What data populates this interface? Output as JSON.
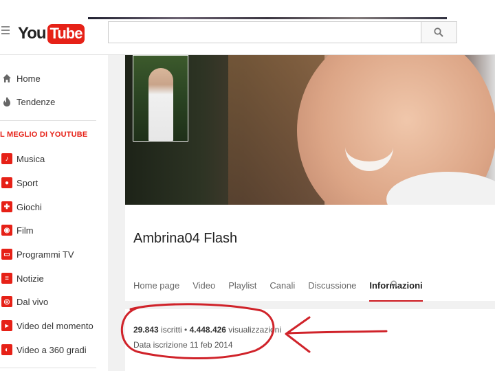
{
  "brand": {
    "logo_you": "You",
    "logo_tube": "Tube",
    "accent": "#e62117"
  },
  "search": {
    "placeholder": ""
  },
  "sidebar": {
    "primary": [
      {
        "label": "Home",
        "icon": "home-icon"
      },
      {
        "label": "Tendenze",
        "icon": "flame-icon"
      }
    ],
    "section_title": "L MEGLIO DI YOUTUBE",
    "items": [
      {
        "label": "Musica",
        "icon": "music-icon"
      },
      {
        "label": "Sport",
        "icon": "sport-icon"
      },
      {
        "label": "Giochi",
        "icon": "gamepad-icon"
      },
      {
        "label": "Film",
        "icon": "film-icon"
      },
      {
        "label": "Programmi TV",
        "icon": "tv-icon"
      },
      {
        "label": "Notizie",
        "icon": "news-icon"
      },
      {
        "label": "Dal vivo",
        "icon": "live-icon"
      },
      {
        "label": "Video del momento",
        "icon": "spotlight-icon"
      },
      {
        "label": "Video a 360 gradi",
        "icon": "360-icon"
      }
    ]
  },
  "channel": {
    "name": "Ambrina04 Flash",
    "tabs": [
      "Home page",
      "Video",
      "Playlist",
      "Canali",
      "Discussione",
      "Informazioni"
    ],
    "active_tab": "Informazioni"
  },
  "about": {
    "subscribers": "29.843",
    "subscribers_label": " iscritti • ",
    "views": "4.448.426",
    "views_label": " visualizzazioni",
    "joined": "Data iscrizione 11 feb 2014"
  },
  "annotation_color": "#d0232a"
}
